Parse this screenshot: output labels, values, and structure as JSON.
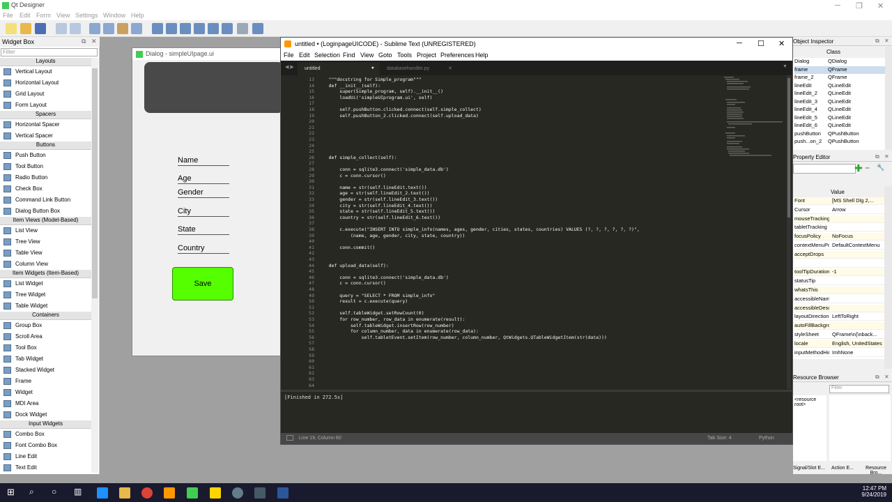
{
  "qt": {
    "title": "Qt Designer",
    "menu": [
      "File",
      "Edit",
      "Form",
      "View",
      "Settings",
      "Window",
      "Help"
    ]
  },
  "widgetbox": {
    "title": "Widget Box",
    "filter": "Filter",
    "items": [
      {
        "cat": "Layouts"
      },
      {
        "l": "Vertical Layout"
      },
      {
        "l": "Horizontal Layout"
      },
      {
        "l": "Grid Layout"
      },
      {
        "l": "Form Layout"
      },
      {
        "cat": "Spacers"
      },
      {
        "l": "Horizontal Spacer"
      },
      {
        "l": "Vertical Spacer"
      },
      {
        "cat": "Buttons"
      },
      {
        "l": "Push Button"
      },
      {
        "l": "Tool Button"
      },
      {
        "l": "Radio Button"
      },
      {
        "l": "Check Box"
      },
      {
        "l": "Command Link Button"
      },
      {
        "l": "Dialog Button Box"
      },
      {
        "cat": "Item Views (Model-Based)"
      },
      {
        "l": "List View"
      },
      {
        "l": "Tree View"
      },
      {
        "l": "Table View"
      },
      {
        "l": "Column View"
      },
      {
        "cat": "Item Widgets (Item-Based)"
      },
      {
        "l": "List Widget"
      },
      {
        "l": "Tree Widget"
      },
      {
        "l": "Table Widget"
      },
      {
        "cat": "Containers"
      },
      {
        "l": "Group Box"
      },
      {
        "l": "Scroll Area"
      },
      {
        "l": "Tool Box"
      },
      {
        "l": "Tab Widget"
      },
      {
        "l": "Stacked Widget"
      },
      {
        "l": "Frame"
      },
      {
        "l": "Widget"
      },
      {
        "l": "MDI Area"
      },
      {
        "l": "Dock Widget"
      },
      {
        "cat": "Input Widgets"
      },
      {
        "l": "Combo Box"
      },
      {
        "l": "Font Combo Box"
      },
      {
        "l": "Line Edit"
      },
      {
        "l": "Text Edit"
      }
    ]
  },
  "dialog": {
    "title": "Dialog - simpleUIpage.ui",
    "labels": [
      "Name",
      "Age",
      "Gender",
      "City",
      "State",
      "Country"
    ],
    "save": "Save"
  },
  "sublime": {
    "title": "untitled • (LoginpageUICODE) - Sublime Text (UNREGISTERED)",
    "menu": [
      "File",
      "Edit",
      "Selection",
      "Find",
      "View",
      "Goto",
      "Tools",
      "Project",
      "Preferences",
      "Help"
    ],
    "tab1": "untitled",
    "tab2": "databasehandler.py",
    "lines": [
      {
        "n": "13",
        "c": "    \"\"\"docstring for Simple_program\"\"\""
      },
      {
        "n": "14",
        "c": "    def __init__(self):"
      },
      {
        "n": "15",
        "c": "        super(Simple_program, self).__init__()"
      },
      {
        "n": "16",
        "c": "        loadUi('simpleUIprogram.ui', self)"
      },
      {
        "n": "17",
        "c": ""
      },
      {
        "n": "18",
        "c": "        self.pushButton.clicked.connect(self.simple_collect)"
      },
      {
        "n": "19",
        "c": "        self.pushButton_2.clicked.connect(self.upload_data)"
      },
      {
        "n": "20",
        "c": ""
      },
      {
        "n": "21",
        "c": ""
      },
      {
        "n": "22",
        "c": ""
      },
      {
        "n": "23",
        "c": ""
      },
      {
        "n": "24",
        "c": ""
      },
      {
        "n": "25",
        "c": ""
      },
      {
        "n": "26",
        "c": "    def simple_collect(self):"
      },
      {
        "n": "27",
        "c": ""
      },
      {
        "n": "28",
        "c": "        conn = sqlite3.connect('simple_data.db')"
      },
      {
        "n": "29",
        "c": "        c = conn.cursor()"
      },
      {
        "n": "30",
        "c": ""
      },
      {
        "n": "31",
        "c": "        name = str(self.lineEdit.text())"
      },
      {
        "n": "32",
        "c": "        age = str(self.lineEdit_2.text())"
      },
      {
        "n": "33",
        "c": "        gender = str(self.lineEdit_3.text())"
      },
      {
        "n": "34",
        "c": "        city = str(self.lineEdit_4.text())"
      },
      {
        "n": "35",
        "c": "        state = str(self.lineEdit_5.text())"
      },
      {
        "n": "36",
        "c": "        country = str(self.lineEdit_6.text())"
      },
      {
        "n": "37",
        "c": ""
      },
      {
        "n": "38",
        "c": "        c.execute(\"INSERT INTO simple_info(names, ages, gender, cities, states, countries) VALUES (?, ?, ?, ?, ?, ?)\","
      },
      {
        "n": "39",
        "c": "            (name, age, gender, city, state, country))"
      },
      {
        "n": "40",
        "c": ""
      },
      {
        "n": "41",
        "c": "        conn.commit()"
      },
      {
        "n": "42",
        "c": ""
      },
      {
        "n": "43",
        "c": ""
      },
      {
        "n": "44",
        "c": "    def upload_data(self):"
      },
      {
        "n": "45",
        "c": ""
      },
      {
        "n": "46",
        "c": "        conn = sqlite3.connect('simple_data.db')"
      },
      {
        "n": "47",
        "c": "        c = conn.cursor()"
      },
      {
        "n": "48",
        "c": ""
      },
      {
        "n": "49",
        "c": "        query = \"SELECT * FROM simple_info\""
      },
      {
        "n": "50",
        "c": "        result = c.execute(query)"
      },
      {
        "n": "51",
        "c": ""
      },
      {
        "n": "52",
        "c": "        self.tableWidget.setRowCount(0)"
      },
      {
        "n": "53",
        "c": "        for row_number, row_data in enumerate(result):"
      },
      {
        "n": "54",
        "c": "            self.tableWidget.insertRow(row_number)"
      },
      {
        "n": "55",
        "c": "            for column_number, data in enumerate(row_data):"
      },
      {
        "n": "56",
        "c": "                self.tabletEvent.setItem(row_number, column_number, QtWidgets.QTableWidgetItem(str(data)))"
      },
      {
        "n": "57",
        "c": ""
      },
      {
        "n": "58",
        "c": ""
      },
      {
        "n": "59",
        "c": ""
      },
      {
        "n": "60",
        "c": ""
      },
      {
        "n": "61",
        "c": ""
      },
      {
        "n": "62",
        "c": ""
      },
      {
        "n": "63",
        "c": ""
      },
      {
        "n": "64",
        "c": ""
      }
    ],
    "output": "[Finished in 272.5s]",
    "status_left": "Line 19, Column 60",
    "status_tab": "Tab Size: 4",
    "status_lang": "Python"
  },
  "inspector": {
    "title": "Object Inspector",
    "col": "Class",
    "rows": [
      [
        "Dialog",
        "QDialog"
      ],
      [
        "frame",
        "QFrame"
      ],
      [
        "frame_2",
        "QFrame"
      ],
      [
        "lineEdit",
        "QLineEdit"
      ],
      [
        "lineEdit_2",
        "QLineEdit"
      ],
      [
        "lineEdit_3",
        "QLineEdit"
      ],
      [
        "lineEdit_4",
        "QLineEdit"
      ],
      [
        "lineEdit_5",
        "QLineEdit"
      ],
      [
        "lineEdit_6",
        "QLineEdit"
      ],
      [
        "pushButton",
        "QPushButton"
      ],
      [
        "push...on_2",
        "QPushButton"
      ]
    ]
  },
  "property": {
    "title": "Property Editor",
    "head": "Value",
    "rows": [
      [
        "Font",
        "[MS Shell Dlg 2,..."
      ],
      [
        "Cursor",
        "Arrow"
      ],
      [
        "mouseTracking",
        ""
      ],
      [
        "tabletTracking",
        ""
      ],
      [
        "focusPolicy",
        "NoFocus"
      ],
      [
        "contextMenuPolicy",
        "DefaultContextMenu"
      ],
      [
        "acceptDrops",
        ""
      ],
      [
        "",
        ""
      ],
      [
        "toolTipDuration",
        "-1"
      ],
      [
        "statusTip",
        ""
      ],
      [
        "whatsThis",
        ""
      ],
      [
        "accessibleName",
        ""
      ],
      [
        "accessibleDescripti...",
        ""
      ],
      [
        "layoutDirection",
        "LeftToRight"
      ],
      [
        "autoFillBackground",
        ""
      ],
      [
        "styleSheet",
        "QFrame\\n{\\nback..."
      ],
      [
        "locale",
        "English, UnitedStates"
      ],
      [
        "inputMethodHints",
        "ImhNone"
      ]
    ]
  },
  "resource": {
    "title": "Resource Browser",
    "filter": "Filter",
    "root": "<resource root>",
    "tabs": [
      "Signal/Slot E...",
      "Action E...",
      "Resource Bro..."
    ]
  },
  "taskbar": {
    "time": "12:47 PM",
    "date": "9/24/2019"
  }
}
